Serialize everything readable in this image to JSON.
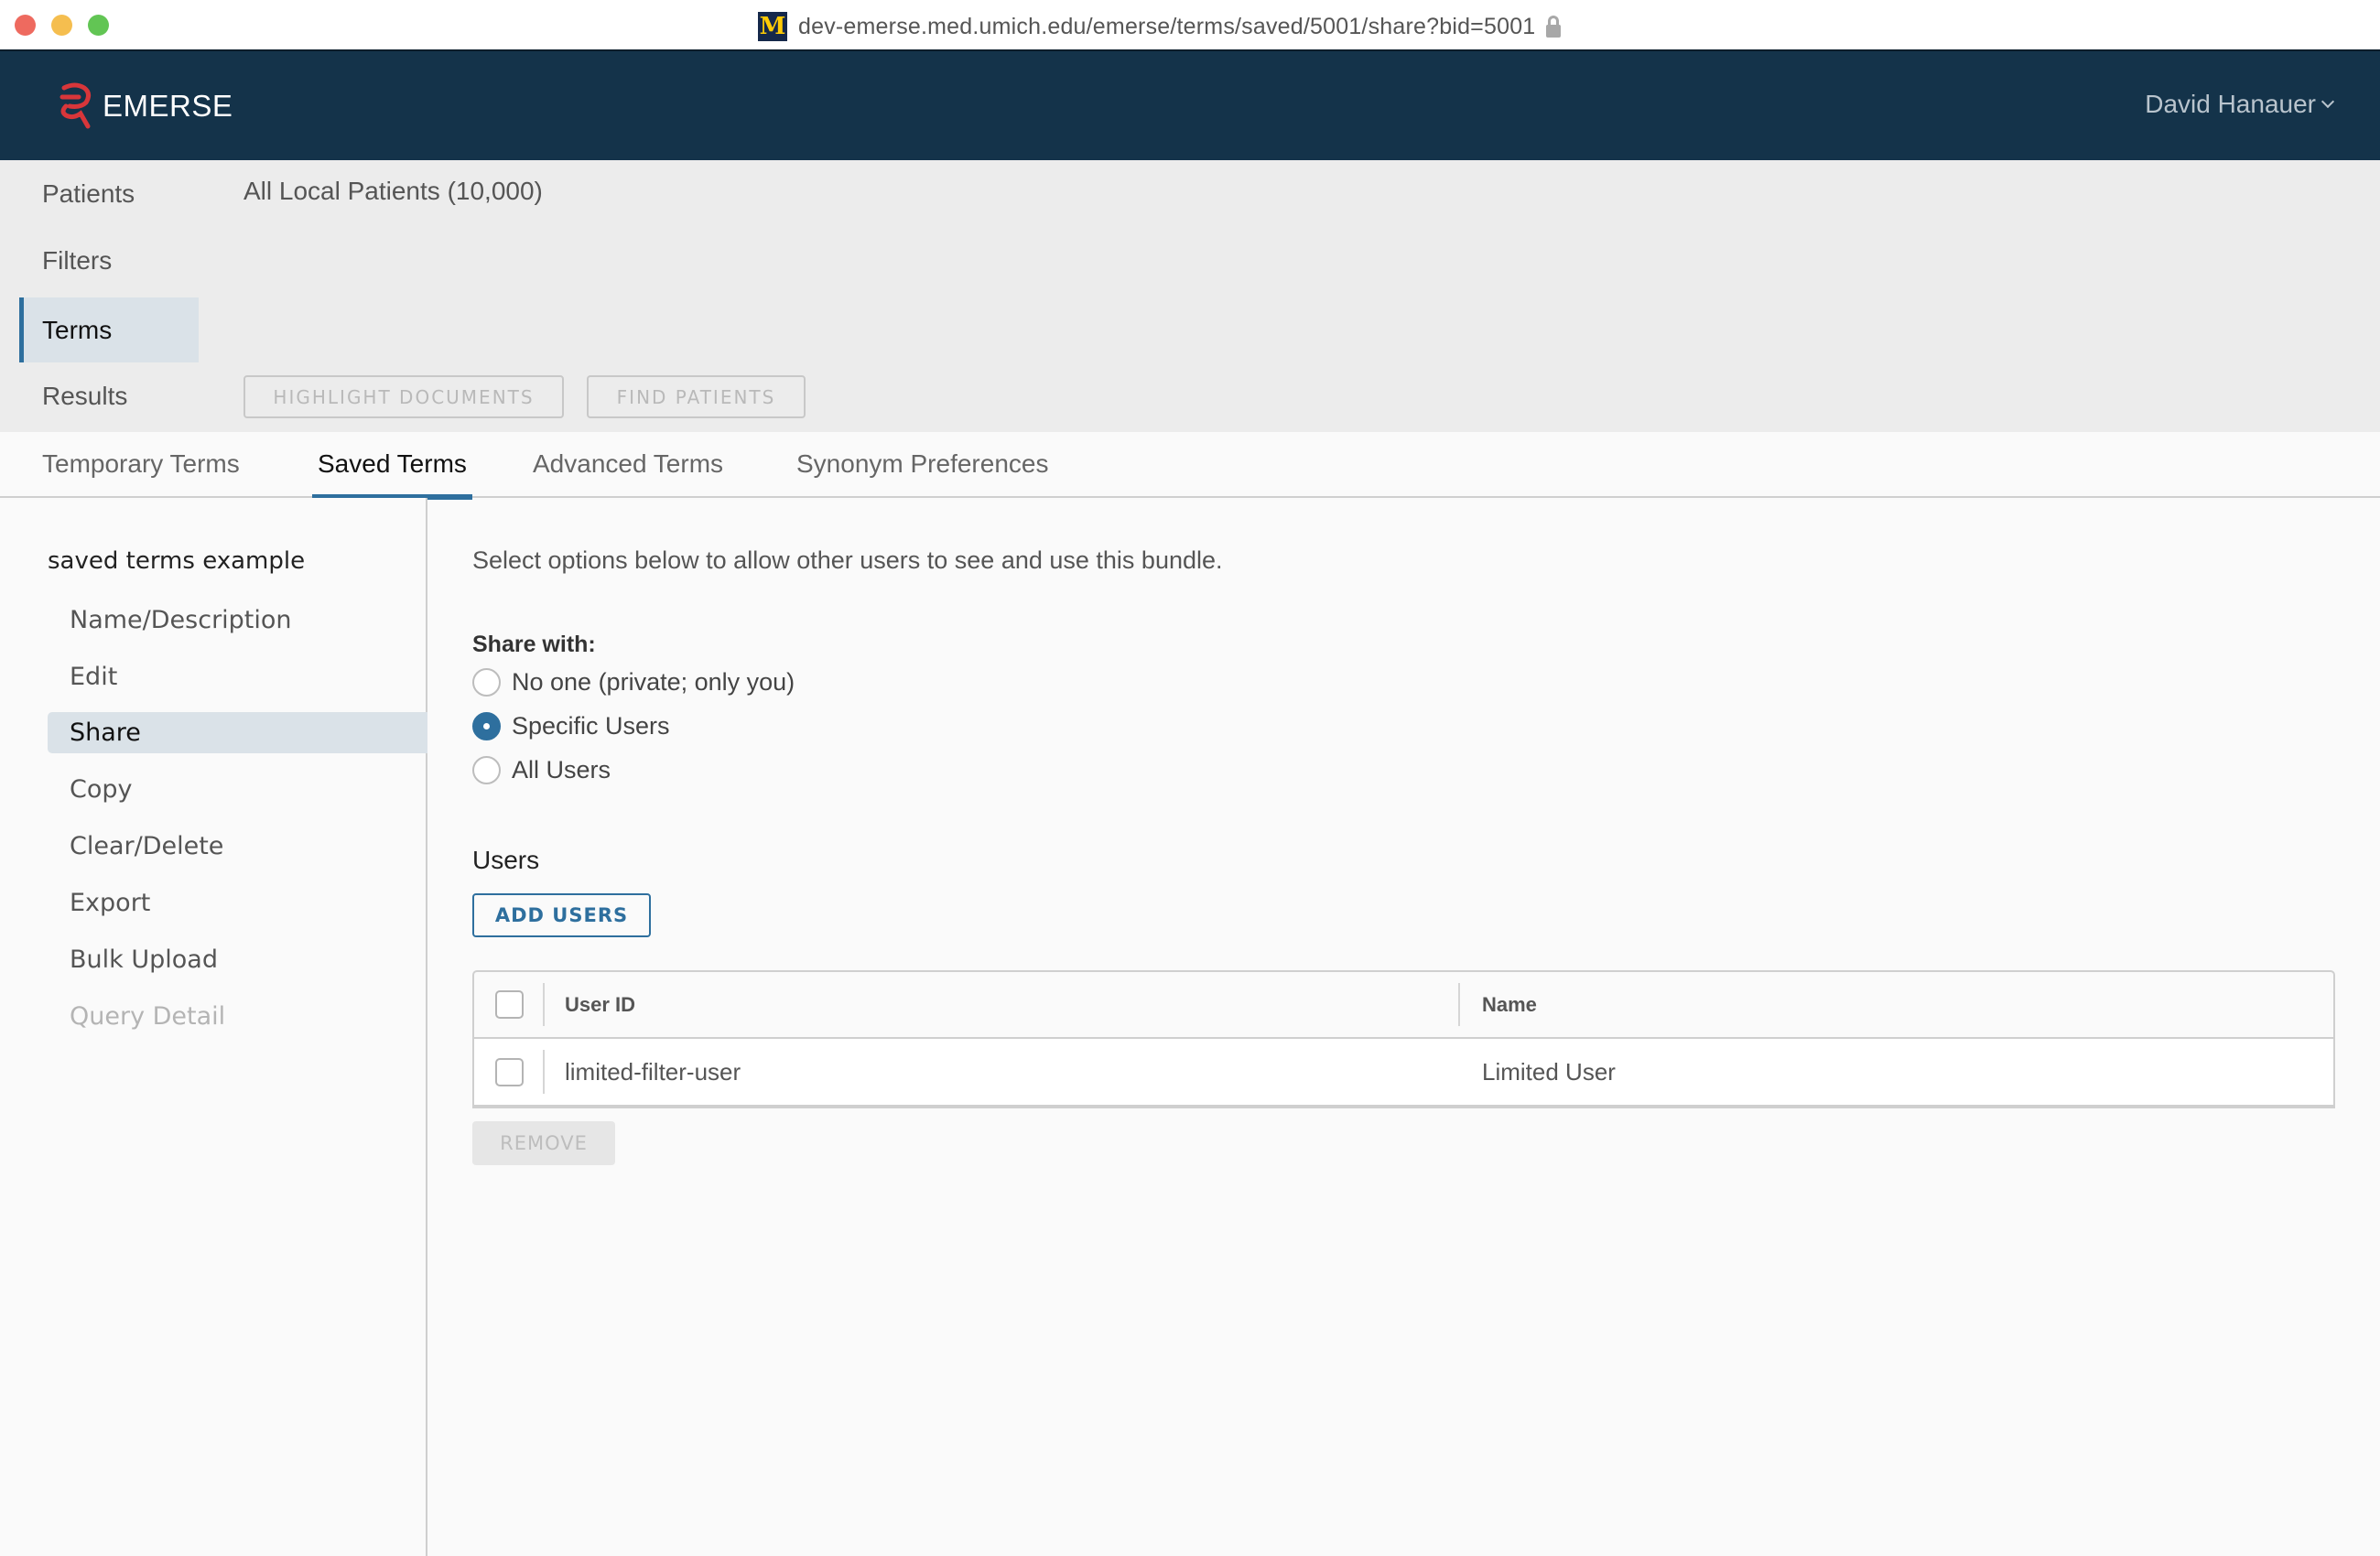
{
  "browser": {
    "url": "dev-emerse.med.umich.edu/emerse/terms/saved/5001/share?bid=5001",
    "site_icon": "umich-block-m-icon",
    "site_icon_glyph": "M",
    "lock_icon": "lock-icon"
  },
  "header": {
    "brand": "EMERSE",
    "brand_color": "#14334a",
    "logo_color": "#d8363a",
    "user_name": "David Hanauer"
  },
  "band": {
    "nav": [
      {
        "label": "Patients",
        "active": false
      },
      {
        "label": "Filters",
        "active": false
      },
      {
        "label": "Terms",
        "active": true
      },
      {
        "label": "Results",
        "active": false
      }
    ],
    "patients_value": "All Local Patients (10,000)",
    "buttons": {
      "highlight": "HIGHLIGHT DOCUMENTS",
      "find": "FIND PATIENTS"
    }
  },
  "tabs": [
    {
      "label": "Temporary Terms",
      "active": false
    },
    {
      "label": "Saved Terms",
      "active": true
    },
    {
      "label": "Advanced Terms",
      "active": false
    },
    {
      "label": "Synonym Preferences",
      "active": false
    }
  ],
  "sidebar": {
    "title": "saved terms example",
    "items": [
      {
        "label": "Name/Description",
        "state": "normal"
      },
      {
        "label": "Edit",
        "state": "normal"
      },
      {
        "label": "Share",
        "state": "active"
      },
      {
        "label": "Copy",
        "state": "normal"
      },
      {
        "label": "Clear/Delete",
        "state": "normal"
      },
      {
        "label": "Export",
        "state": "normal"
      },
      {
        "label": "Bulk Upload",
        "state": "normal"
      },
      {
        "label": "Query Detail",
        "state": "disabled"
      }
    ]
  },
  "share": {
    "intro": "Select options below to allow other users to see and use this bundle.",
    "share_with_label": "Share with:",
    "options": [
      {
        "label": "No one (private; only you)",
        "checked": false
      },
      {
        "label": "Specific Users",
        "checked": true
      },
      {
        "label": "All Users",
        "checked": false
      }
    ],
    "accent_color": "#2e6f9e"
  },
  "users": {
    "heading": "Users",
    "add_button": "ADD USERS",
    "remove_button": "REMOVE",
    "columns": [
      "User ID",
      "Name"
    ],
    "rows": [
      {
        "user_id": "limited-filter-user",
        "name": "Limited User",
        "selected": false
      }
    ]
  }
}
